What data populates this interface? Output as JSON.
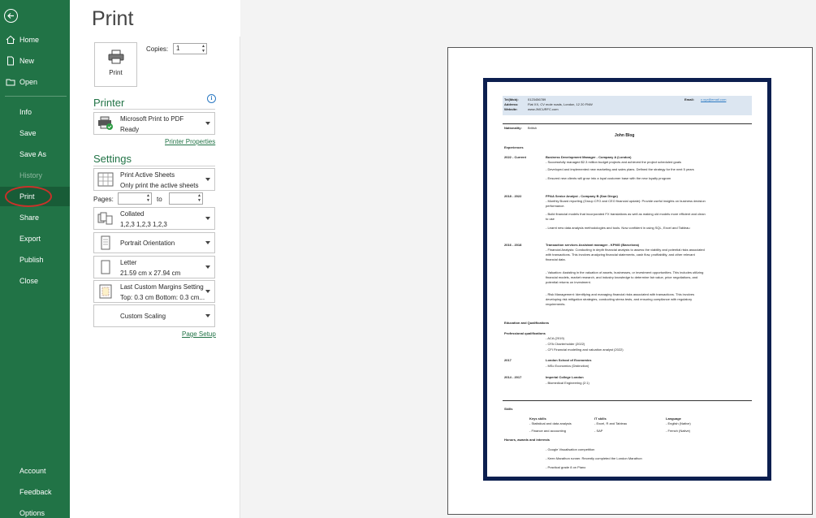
{
  "sidebar": {
    "items": [
      {
        "label": "Home",
        "icon": "home-icon"
      },
      {
        "label": "New",
        "icon": "new-document-icon"
      },
      {
        "label": "Open",
        "icon": "open-folder-icon"
      },
      {
        "label": "Info"
      },
      {
        "label": "Save"
      },
      {
        "label": "Save As"
      },
      {
        "label": "History"
      },
      {
        "label": "Print"
      },
      {
        "label": "Share"
      },
      {
        "label": "Export"
      },
      {
        "label": "Publish"
      },
      {
        "label": "Close"
      },
      {
        "label": "Account"
      },
      {
        "label": "Feedback"
      },
      {
        "label": "Options"
      }
    ]
  },
  "print": {
    "title": "Print",
    "button_label": "Print",
    "copies_label": "Copies:",
    "copies_value": "1",
    "printer_heading": "Printer",
    "printer_name": "Microsoft Print to PDF",
    "printer_status": "Ready",
    "printer_properties": "Printer Properties",
    "settings_heading": "Settings",
    "scope_title": "Print Active Sheets",
    "scope_sub": "Only print the active sheets",
    "pages_label": "Pages:",
    "to_label": "to",
    "collate_title": "Collated",
    "collate_sub": "1,2,3    1,2,3    1,2,3",
    "orientation": "Portrait Orientation",
    "paper_title": "Letter",
    "paper_sub": "21.59 cm x 27.94 cm",
    "margins_title": "Last Custom Margins Setting",
    "margins_sub": "Top: 0.3 cm Bottom: 0.3 cm...",
    "scaling": "Custom Scaling",
    "page_setup": "Page Setup"
  },
  "resume": {
    "tel_label": "Tel(Mob):",
    "tel_value": "0123456789",
    "address_label": "Address:",
    "address_value": "Flat XX, CV mole roads, London, 12 20 FNW",
    "website_label": "Website:",
    "website_value": "www.JMCURFC.com",
    "email_label": "Email:",
    "email_value": "c.xyz@email.com",
    "nationality_label": "Nationality:",
    "nationality_value": "British",
    "name": "John Blog",
    "experience_h": "Experiences",
    "d1": "2022 - Current",
    "j1": "Business Development Manager - Company A (London)",
    "j1a": "- Successfully managed $2.3 million budget projects and achieved the project scheduled goals",
    "j1b": "- Developed and implemented new marketing and sales plans. Defined the strategy for the next 5 years",
    "j1c": "- Ensured new clients will grow into a loyal customer base with the new loyalty program",
    "d2": "2018 - 2022",
    "j2": "FP&A Senior Analyst - Company B (San Diego)",
    "j2a": "- Monthly Board reporting (Group CFO and CEO financial update): Provide useful insights on business decision",
    "j2a2": "performance.",
    "j2b": "- Build financial models that incorporated FX translations as well as making old models more efficient and clean",
    "j2b2": "to use",
    "j2c": "- Learnt new data analysis methodologies and tools. Now confident in using SQL, Excel and Tableau",
    "d3": "2016 - 2018",
    "j3": "Transaction services Assistant manager - KPMG (Barcelona)",
    "j3a": "- Financial Analysis: Conducting in depth financial analysis to assess the viability and potential risks associated",
    "j3a2": "with transactions. This involves analyzing financial statements, cash flow, profitability, and other relevant",
    "j3a3": "financial data.",
    "j3b": "- Valuation: Assisting in the valuation of assets, businesses, or investment opportunities. This includes utilizing",
    "j3b2": "financial models, market research, and industry knowledge to determine fair value, price negotiations, and",
    "j3b3": "potential returns on investment.",
    "j3c": "- Risk Management: Identifying and managing financial risks associated with transactions. This involves",
    "j3c2": "developing risk mitigation strategies, conducting stress tests, and ensuring compliance with regulatory",
    "j3c3": "requirements.",
    "edu_h": "Education and Qualifications",
    "prof_h": "Professional qualifications",
    "q1": "- ACA (2019)",
    "q2": "- CFA Charterholder (2022)",
    "q3": "- CFI Financial modelling and valuation analyst (2022)",
    "e1d": "2017",
    "e1": "London School of Economics",
    "e1a": "- MSc Economics (Distinction)",
    "e2d": "2014 - 2017",
    "e2": "Imperial College London",
    "e2a": "- Biomedical Engineering (2:1)",
    "skills_h": "Skills",
    "k_h": "Keys skills",
    "k1": "- Statistical and data analysis",
    "k2": "- Finance and accounting",
    "it_h": "IT skills",
    "it1": "- Excel, R and Tableau",
    "it2": "- SAP",
    "l_h": "Language",
    "l1": "- English (Native)",
    "l2": "- French (Native)",
    "hon_h": "Honors, awards and interests",
    "h1": "- Google Visualisation competition",
    "h2": "- Keen Marathon runner. Recently completed the London Marathon",
    "h3": "- Practical grade 8 on Piano"
  }
}
